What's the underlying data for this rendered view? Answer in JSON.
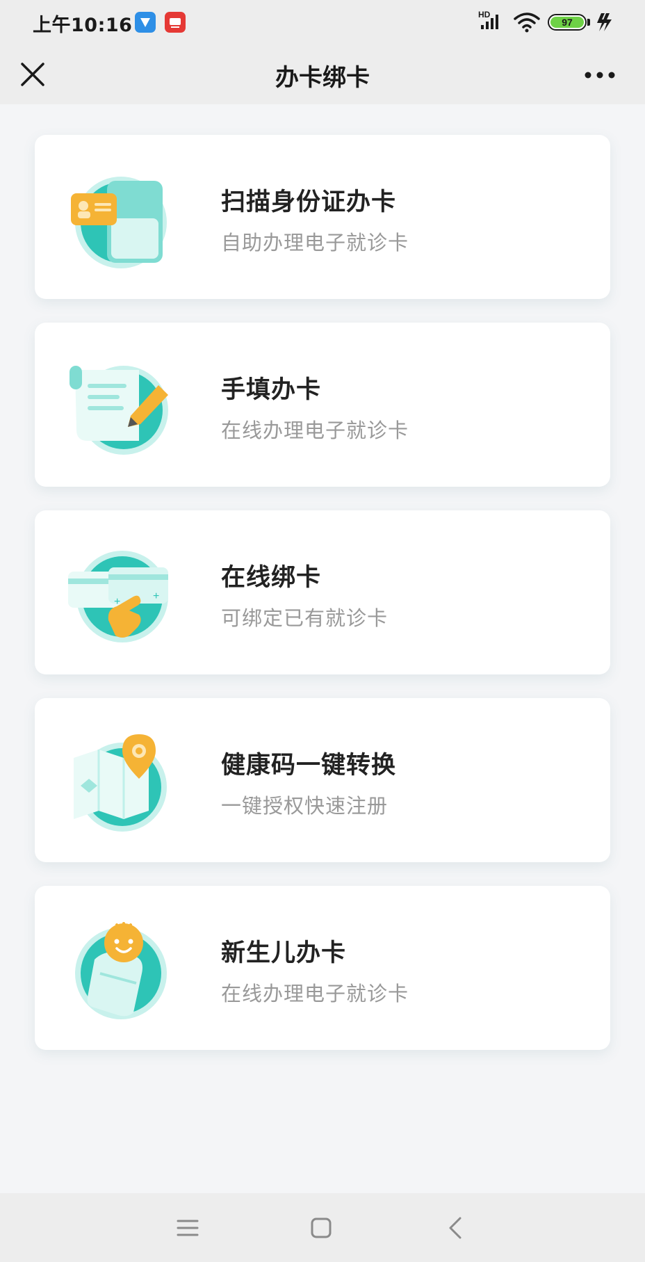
{
  "status_bar": {
    "time": "上午10:16",
    "network": "HD",
    "battery": "97"
  },
  "nav": {
    "title": "办卡绑卡"
  },
  "cards": [
    {
      "title": "扫描身份证办卡",
      "subtitle": "自助办理电子就诊卡",
      "icon": "id-card-scan-icon"
    },
    {
      "title": "手填办卡",
      "subtitle": "在线办理电子就诊卡",
      "icon": "form-fill-icon"
    },
    {
      "title": "在线绑卡",
      "subtitle": "可绑定已有就诊卡",
      "icon": "card-bind-icon"
    },
    {
      "title": "健康码一键转换",
      "subtitle": "一键授权快速注册",
      "icon": "health-code-map-icon"
    },
    {
      "title": "新生儿办卡",
      "subtitle": "在线办理电子就诊卡",
      "icon": "newborn-baby-icon"
    }
  ],
  "colors": {
    "teal": "#2ec4b6",
    "teal_light": "#c8f1ec",
    "orange": "#f5b335",
    "page_bg": "#f4f5f7"
  }
}
